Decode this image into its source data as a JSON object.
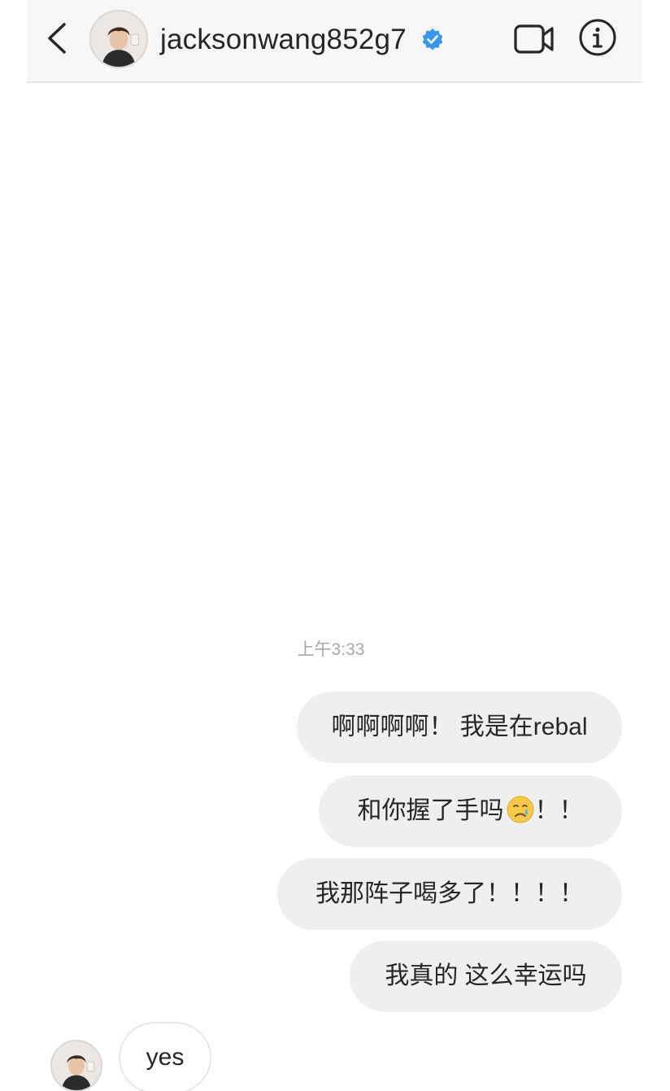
{
  "header": {
    "username": "jacksonwang852g7",
    "verified": true,
    "icons": {
      "back": "chevron-left-icon",
      "verified": "verified-badge-icon",
      "video_call": "video-camera-icon",
      "info": "info-icon"
    }
  },
  "conversation": {
    "timestamp": "上午3:33",
    "outgoing": [
      {
        "text": "啊啊啊啊！ 我是在rebal"
      },
      {
        "text": "和你握了手吗",
        "emoji": "crying-face-emoji",
        "suffix": "！！"
      },
      {
        "text": "我那阵子喝多了！！！！"
      },
      {
        "text": "我真的 这么幸运吗"
      }
    ],
    "incoming": [
      {
        "text": "yes"
      }
    ]
  },
  "colors": {
    "header_bg": "#f7f7f7",
    "bubble_outgoing": "#efefef",
    "bubble_incoming_border": "#e8e8e8",
    "verified_blue": "#3897f0",
    "timestamp_gray": "#a8a8a8",
    "text": "#262626"
  }
}
